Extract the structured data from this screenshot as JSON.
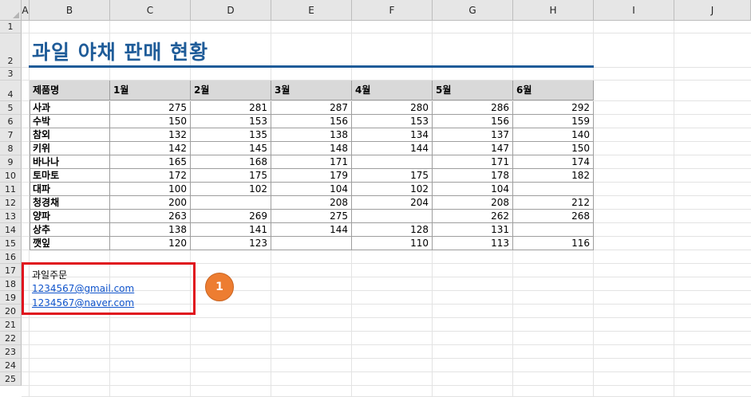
{
  "columns": [
    "A",
    "B",
    "C",
    "D",
    "E",
    "F",
    "G",
    "H",
    "I",
    "J"
  ],
  "rows": [
    "1",
    "2",
    "3",
    "4",
    "5",
    "6",
    "7",
    "8",
    "9",
    "10",
    "11",
    "12",
    "13",
    "14",
    "15",
    "16",
    "17",
    "18",
    "19",
    "20",
    "21",
    "22",
    "23",
    "24",
    "25"
  ],
  "title": "과일 야채 판매 현황",
  "table": {
    "headers": [
      "제품명",
      "1월",
      "2월",
      "3월",
      "4월",
      "5월",
      "6월"
    ],
    "rows": [
      [
        "사과",
        "275",
        "281",
        "287",
        "280",
        "286",
        "292"
      ],
      [
        "수박",
        "150",
        "153",
        "156",
        "153",
        "156",
        "159"
      ],
      [
        "참외",
        "132",
        "135",
        "138",
        "134",
        "137",
        "140"
      ],
      [
        "키위",
        "142",
        "145",
        "148",
        "144",
        "147",
        "150"
      ],
      [
        "바나나",
        "165",
        "168",
        "171",
        "",
        "171",
        "174"
      ],
      [
        "토마토",
        "172",
        "175",
        "179",
        "175",
        "178",
        "182"
      ],
      [
        "대파",
        "100",
        "102",
        "104",
        "102",
        "104",
        ""
      ],
      [
        "청경채",
        "200",
        "",
        "208",
        "204",
        "208",
        "212"
      ],
      [
        "양파",
        "263",
        "269",
        "275",
        "",
        "262",
        "268"
      ],
      [
        "상추",
        "138",
        "141",
        "144",
        "128",
        "131",
        ""
      ],
      [
        "깻잎",
        "120",
        "123",
        "",
        "110",
        "113",
        "116"
      ]
    ]
  },
  "order": {
    "label": "과일주문",
    "links": [
      "1234567@gmail.com",
      "1234567@naver.com"
    ]
  },
  "callout": {
    "number": "1",
    "color": "#ed7d31",
    "box_color": "#e0141e"
  },
  "colors": {
    "title": "#1f5c99",
    "header_fill": "#d9d9d9",
    "link": "#1155cc"
  }
}
